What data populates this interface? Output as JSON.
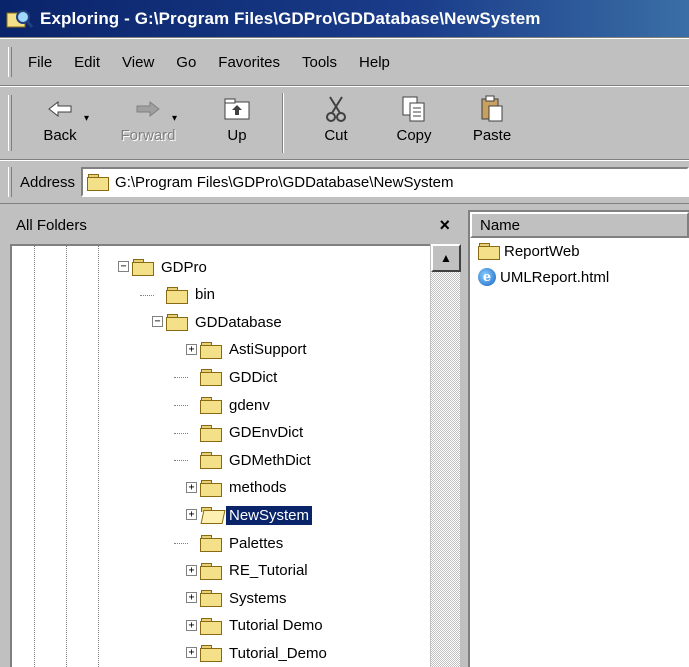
{
  "window": {
    "title": "Exploring - G:\\Program Files\\GDPro\\GDDatabase\\NewSystem"
  },
  "menu": [
    "File",
    "Edit",
    "View",
    "Go",
    "Favorites",
    "Tools",
    "Help"
  ],
  "toolbar": {
    "back": "Back",
    "forward": "Forward",
    "up": "Up",
    "cut": "Cut",
    "copy": "Copy",
    "paste": "Paste"
  },
  "address": {
    "label": "Address",
    "value": "G:\\Program Files\\GDPro\\GDDatabase\\NewSystem"
  },
  "folders_pane": {
    "title": "All Folders",
    "close": "×"
  },
  "tree": [
    {
      "label": "GDPro",
      "expander": "−"
    },
    {
      "label": "bin"
    },
    {
      "label": "GDDatabase",
      "expander": "−"
    },
    {
      "label": "AstiSupport",
      "expander": "+"
    },
    {
      "label": "GDDict"
    },
    {
      "label": "gdenv"
    },
    {
      "label": "GDEnvDict"
    },
    {
      "label": "GDMethDict"
    },
    {
      "label": "methods",
      "expander": "+"
    },
    {
      "label": "NewSystem",
      "expander": "+",
      "selected": true
    },
    {
      "label": "Palettes"
    },
    {
      "label": "RE_Tutorial",
      "expander": "+"
    },
    {
      "label": "Systems",
      "expander": "+"
    },
    {
      "label": "Tutorial Demo",
      "expander": "+"
    },
    {
      "label": "Tutorial_Demo",
      "expander": "+"
    }
  ],
  "list": {
    "column": "Name",
    "items": [
      {
        "name": "ReportWeb",
        "icon": "folder-icon"
      },
      {
        "name": "UMLReport.html",
        "icon": "ie-html-icon"
      }
    ]
  },
  "colors": {
    "title_bar": "#0a246a",
    "selection": "#0a246a",
    "face": "#c0c0c0"
  }
}
